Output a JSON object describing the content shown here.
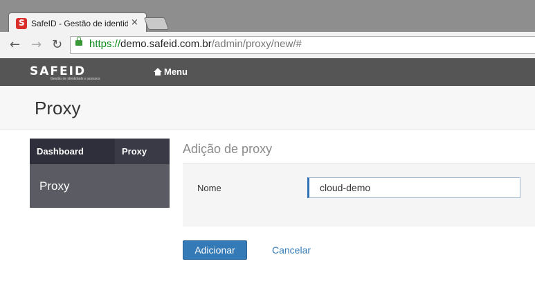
{
  "browser": {
    "tab_title": "SafeID - Gestão de identid",
    "tab_close": "×",
    "url_scheme": "https://",
    "url_host": "demo.safeid.com.br",
    "url_path": "/admin/proxy/new/#",
    "lock_color": "#3a9a3a"
  },
  "app": {
    "logo_text": "SAFEID",
    "logo_tagline": "Gestão de identidade e acessos",
    "menu_label": "Menu",
    "header_color": "#555555"
  },
  "page": {
    "title": "Proxy"
  },
  "sidebar": {
    "breadcrumbs": [
      "Dashboard",
      "Proxy"
    ],
    "section_label": "Proxy"
  },
  "form": {
    "heading": "Adição de proxy",
    "name_label": "Nome",
    "name_value": "cloud-demo",
    "submit_label": "Adicionar",
    "cancel_label": "Cancelar",
    "primary_color": "#337ab7"
  },
  "icons": {
    "back": "arrow-left-icon",
    "forward": "arrow-right-icon",
    "reload": "reload-icon",
    "lock": "lock-icon",
    "home": "home-icon",
    "favicon": "safeid-favicon-icon"
  }
}
